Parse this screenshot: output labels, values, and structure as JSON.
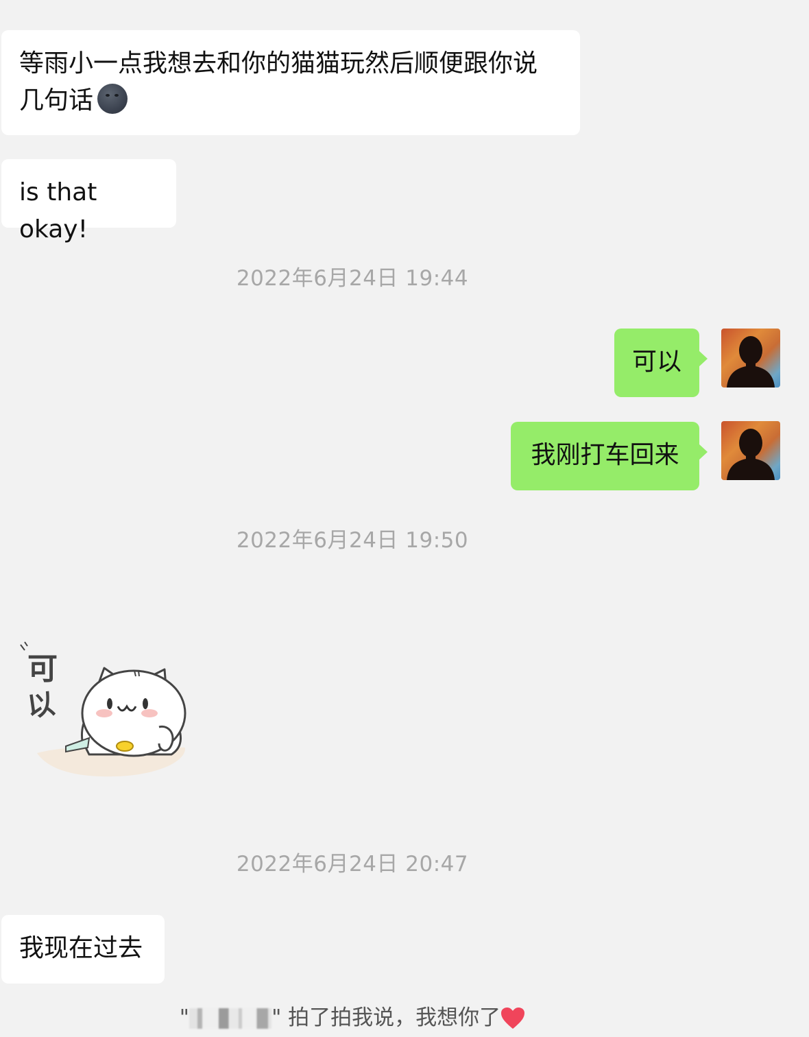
{
  "messages": {
    "m1": {
      "text_line1": "等雨小一点我想去和你的猫猫玩然后顺便跟你说",
      "text_line2": "几句话"
    },
    "m2": {
      "text": "is that okay!"
    },
    "t1": "2022年6月24日 19:44",
    "m3": {
      "text": "可以"
    },
    "m4": {
      "text": "我刚打车回来"
    },
    "t2": "2022年6月24日 19:50",
    "sticker": {
      "text": "可以"
    },
    "t3": "2022年6月24日 20:47",
    "m5": {
      "text": "我现在过去"
    },
    "system": {
      "quote_open": "\"",
      "quote_close": "\"",
      "text": " 拍了拍我说，我想你了"
    }
  },
  "colors": {
    "background": "#f2f2f2",
    "incoming_bubble": "#ffffff",
    "outgoing_bubble": "#95ec69",
    "timestamp": "#a7a7a7"
  },
  "icons": [
    "new-moon-face-emoji",
    "avatar-silhouette",
    "cat-sticker",
    "heart-icon"
  ]
}
